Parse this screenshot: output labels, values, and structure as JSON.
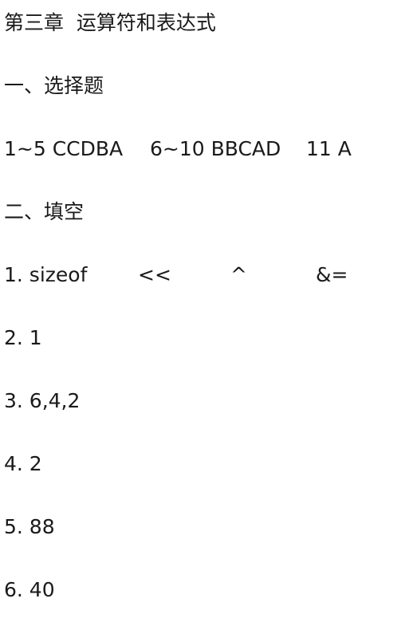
{
  "chapter_title": "第三章  运算符和表达式",
  "section_choice": {
    "heading": "一、选择题",
    "answers": [
      "1~5 CCDBA",
      "6~10 BBCAD",
      "11 A"
    ]
  },
  "section_fill": {
    "heading": "二、填空",
    "items": [
      [
        "1. sizeof",
        "<<",
        "^",
        "&="
      ],
      "2. 1",
      "3. 6,4,2",
      "4. 2",
      "5. 88",
      "6. 40"
    ]
  }
}
